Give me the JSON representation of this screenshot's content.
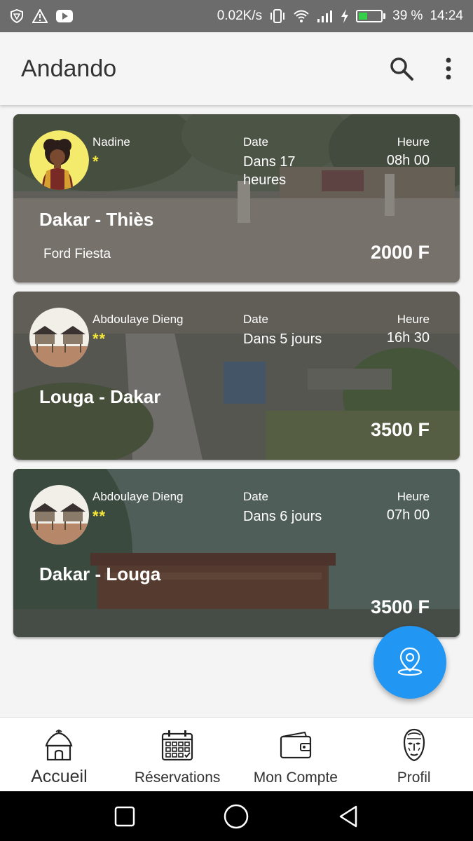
{
  "status_bar": {
    "network_speed": "0.02K/s",
    "battery_percent": "39 %",
    "time": "14:24",
    "battery_level": 0.39,
    "icons": [
      "shield-icon",
      "warning-icon",
      "youtube-icon",
      "vibrate-icon",
      "wifi-icon",
      "signal-icon",
      "charging-icon",
      "battery-icon"
    ]
  },
  "app_bar": {
    "title": "Andando",
    "icons": [
      "search-icon",
      "more-vert-icon"
    ]
  },
  "trips": [
    {
      "driver": "Nadine",
      "rating": "*",
      "date_label": "Date",
      "date_value": "Dans 17 heures",
      "hour_label": "Heure",
      "hour_value": "08h 00",
      "route": "Dakar - Thiès",
      "car": "Ford Fiesta",
      "price": "2000 F"
    },
    {
      "driver": "Abdoulaye Dieng",
      "rating": "**",
      "date_label": "Date",
      "date_value": "Dans 5 jours",
      "hour_label": "Heure",
      "hour_value": "16h 30",
      "route": "Louga - Dakar",
      "car": "",
      "price": "3500 F"
    },
    {
      "driver": "Abdoulaye Dieng",
      "rating": "**",
      "date_label": "Date",
      "date_value": "Dans 6 jours",
      "hour_label": "Heure",
      "hour_value": "07h 00",
      "route": "Dakar - Louga",
      "car": "",
      "price": "3500 F"
    }
  ],
  "fab": {
    "icon": "location-pin-icon"
  },
  "bottom_nav": [
    {
      "label": "Accueil",
      "icon": "hut-icon",
      "active": true
    },
    {
      "label": "Réservations",
      "icon": "calendar-icon",
      "active": false
    },
    {
      "label": "Mon Compte",
      "icon": "wallet-icon",
      "active": false
    },
    {
      "label": "Profil",
      "icon": "mask-icon",
      "active": false
    }
  ],
  "colors": {
    "accent": "#2196f3",
    "star": "#f5e63a",
    "status_bar": "#6c6c6c",
    "battery_fill": "#35d04a"
  }
}
